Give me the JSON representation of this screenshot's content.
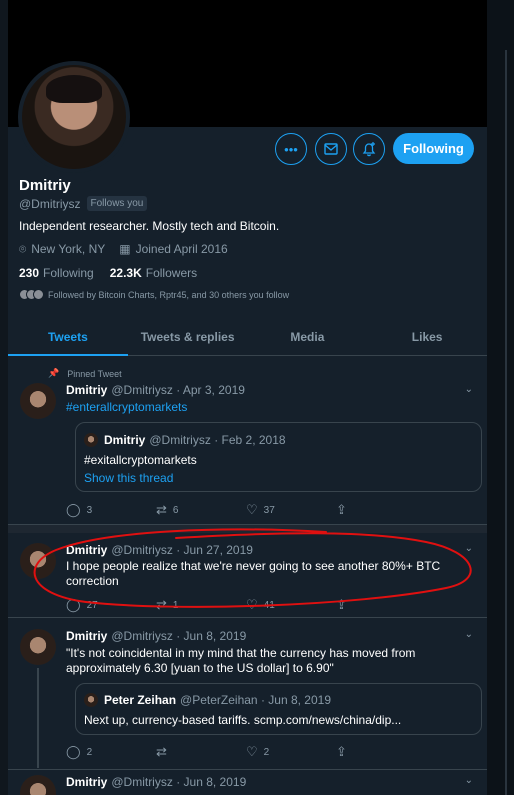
{
  "profile": {
    "name": "Dmitriy",
    "handle": "@Dmitriysz",
    "follows_you": "Follows you",
    "bio": "Independent researcher. Mostly tech and Bitcoin.",
    "location": "New York, NY",
    "joined": "Joined April 2016",
    "following_count": "230",
    "following_label": "Following",
    "followers_count": "22.3K",
    "followers_label": "Followers",
    "followed_by": "Followed by Bitcoin Charts, Rptr45, and 30 others you follow"
  },
  "actions": {
    "more_icon": "more-icon",
    "message_icon": "mail-icon",
    "notify_icon": "bell-plus-icon",
    "follow_label": "Following"
  },
  "tabs": [
    "Tweets",
    "Tweets & replies",
    "Media",
    "Likes"
  ],
  "tweets": [
    {
      "pinned_label": "Pinned Tweet",
      "name": "Dmitriy",
      "handle": "@Dmitriysz",
      "date": "· Apr 3, 2019",
      "text": "#enterallcryptomarkets",
      "quote": {
        "name": "Dmitriy",
        "handle": "@Dmitriysz",
        "date": "· Feb 2, 2018",
        "text": "#exitallcryptomarkets",
        "link": "Show this thread"
      },
      "replies": "3",
      "retweets": "6",
      "likes": "37"
    },
    {
      "name": "Dmitriy",
      "handle": "@Dmitriysz",
      "date": "· Jun 27, 2019",
      "text": "I hope people realize that we're never going to see another 80%+ BTC correction",
      "replies": "27",
      "retweets": "1",
      "likes": "41"
    },
    {
      "name": "Dmitriy",
      "handle": "@Dmitriysz",
      "date": "· Jun 8, 2019",
      "text": "\"It's not coincidental in my mind that the currency has moved from approximately 6.30 [yuan to the US dollar] to 6.90\"",
      "quote": {
        "name": "Peter Zeihan",
        "handle": "@PeterZeihan",
        "date": "· Jun 8, 2019",
        "text": "Next up, currency-based tariffs.  scmp.com/news/china/dip..."
      },
      "replies": "2",
      "retweets": "",
      "likes": "2"
    },
    {
      "name": "Dmitriy",
      "handle": "@Dmitriysz",
      "date": "· Jun 8, 2019"
    }
  ],
  "colors": {
    "accent": "#1da1f2",
    "background": "#15202b",
    "annotation": "#e01010"
  }
}
